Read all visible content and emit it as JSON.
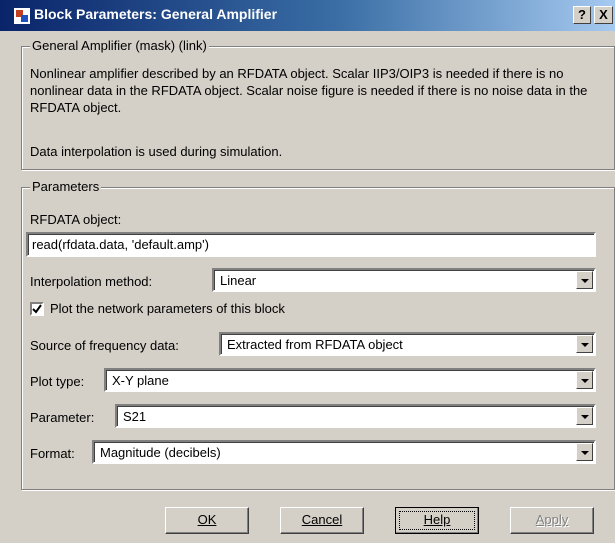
{
  "window": {
    "title": "Block Parameters: General Amplifier",
    "help_glyph": "?",
    "close_glyph": "X"
  },
  "mask": {
    "group_label": "General Amplifier (mask) (link)",
    "description": "Nonlinear amplifier described by an RFDATA object. Scalar IIP3/OIP3 is needed if there is no nonlinear data in the RFDATA object.  Scalar noise figure is needed if there is no noise data in the RFDATA object.",
    "note": "Data interpolation is used during simulation."
  },
  "params": {
    "group_label": "Parameters",
    "rfdata_label": "RFDATA object:",
    "rfdata_value": "read(rfdata.data, 'default.amp')",
    "interp_label": "Interpolation method:",
    "interp_value": "Linear",
    "plot_check_label": "Plot the network parameters of this block",
    "plot_checked": true,
    "source_label": "Source of frequency data:",
    "source_value": "Extracted from RFDATA object",
    "plottype_label": "Plot type:",
    "plottype_value": "X-Y plane",
    "parameter_label": "Parameter:",
    "parameter_value": "S21",
    "format_label": "Format:",
    "format_value": "Magnitude (decibels)"
  },
  "buttons": {
    "ok": "OK",
    "cancel": "Cancel",
    "help": "Help",
    "apply": "Apply"
  },
  "icons": {
    "title_icon": "simulink-block-icon",
    "check_mark": "checkmark-icon",
    "dropdown": "chevron-down-icon"
  }
}
